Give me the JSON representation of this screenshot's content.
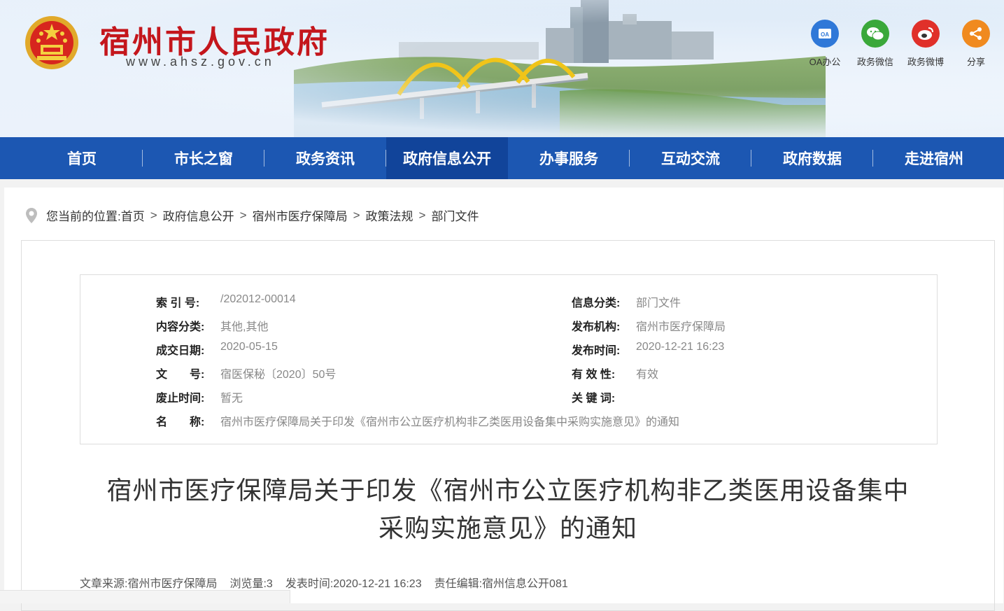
{
  "header": {
    "site_title": "宿州市人民政府",
    "site_url": "www.ahsz.gov.cn",
    "icons": [
      {
        "label": "OA办公",
        "icon": "oa-icon",
        "color": "#2f78d8",
        "glyph": "OA"
      },
      {
        "label": "政务微信",
        "icon": "wechat-icon",
        "color": "#3aa83a",
        "glyph": "◕◕"
      },
      {
        "label": "政务微博",
        "icon": "weibo-icon",
        "color": "#e0302a",
        "glyph": "◎"
      },
      {
        "label": "分享",
        "icon": "share-icon",
        "color": "#f08a1f",
        "glyph": "≺"
      }
    ]
  },
  "nav": {
    "items": [
      {
        "label": "首页"
      },
      {
        "label": "市长之窗"
      },
      {
        "label": "政务资讯"
      },
      {
        "label": "政府信息公开",
        "active": true
      },
      {
        "label": "办事服务"
      },
      {
        "label": "互动交流"
      },
      {
        "label": "政府数据"
      },
      {
        "label": "走进宿州"
      }
    ]
  },
  "breadcrumb": {
    "prefix": "您当前的位置:",
    "items": [
      "首页",
      "政府信息公开",
      "宿州市医疗保障局",
      "政策法规",
      "部门文件"
    ],
    "separator": ">"
  },
  "meta": {
    "index_no": {
      "key": "索 引 号:",
      "value": "/202012-00014"
    },
    "content_class": {
      "key": "内容分类:",
      "value": "其他,其他"
    },
    "created_date": {
      "key": "成交日期:",
      "value": "2020-05-15"
    },
    "doc_no": {
      "key": "文　　号:",
      "value": "宿医保秘〔2020〕50号"
    },
    "abolish_time": {
      "key": "废止时间:",
      "value": "暂无"
    },
    "name": {
      "key": "名　　称:",
      "value": "宿州市医疗保障局关于印发《宿州市公立医疗机构非乙类医用设备集中采购实施意见》的通知"
    },
    "info_class": {
      "key": "信息分类:",
      "value": "部门文件"
    },
    "issuer": {
      "key": "发布机构:",
      "value": "宿州市医疗保障局"
    },
    "publish_time": {
      "key": "发布时间:",
      "value": "2020-12-21 16:23"
    },
    "validity": {
      "key": "有 效 性:",
      "value": "有效"
    },
    "keywords": {
      "key": "关 键 词:",
      "value": ""
    }
  },
  "article": {
    "title_line1": "宿州市医疗保障局关于印发《宿州市公立医疗机构非乙类医用设备集中",
    "title_line2": "采购实施意见》的通知",
    "source": "文章来源:宿州市医疗保障局",
    "views": "浏览量:3",
    "published": "发表时间:2020-12-21 16:23",
    "editor": "责任编辑:宿州信息公开081"
  }
}
